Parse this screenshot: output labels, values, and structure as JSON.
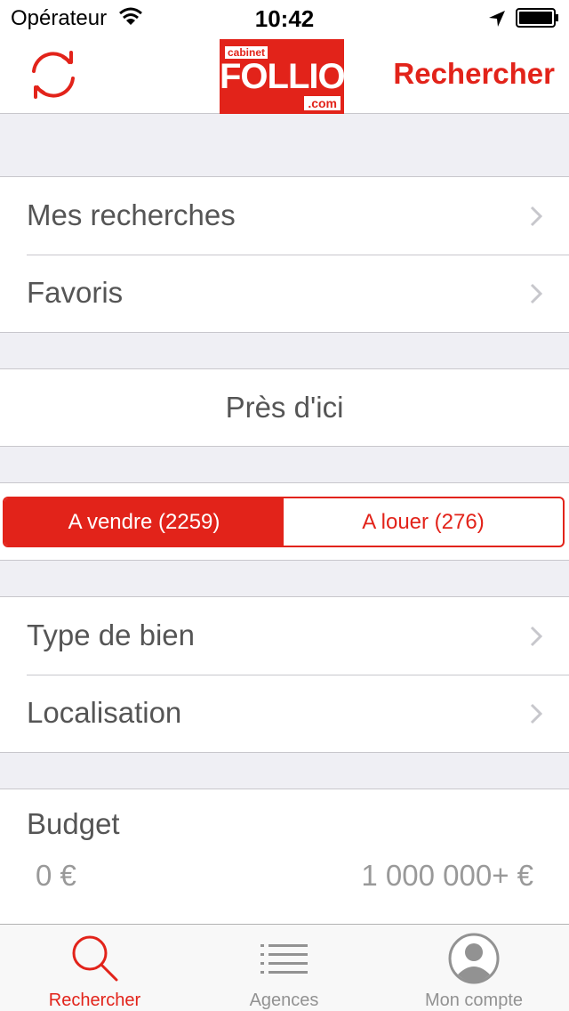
{
  "status_bar": {
    "carrier": "Opérateur",
    "time": "10:42"
  },
  "nav": {
    "logo_top": "cabinet",
    "logo_brand": "FOLLIOT",
    "logo_suffix": ".com",
    "action_label": "Rechercher"
  },
  "menu": {
    "my_searches": "Mes recherches",
    "favorites": "Favoris"
  },
  "nearby": "Près d'ici",
  "segments": {
    "sell": "A vendre (2259)",
    "rent": "A louer (276)",
    "selected": "sell"
  },
  "filters": {
    "property_type": "Type de bien",
    "location": "Localisation"
  },
  "budget": {
    "title": "Budget",
    "min": "0 €",
    "max": "1 000 000+ €"
  },
  "tabs": [
    {
      "label": "Rechercher",
      "icon": "search-icon",
      "active": true
    },
    {
      "label": "Agences",
      "icon": "list-icon",
      "active": false
    },
    {
      "label": "Mon compte",
      "icon": "user-icon",
      "active": false
    }
  ],
  "colors": {
    "accent": "#e2231a",
    "background": "#efeff4",
    "text": "#555555"
  }
}
